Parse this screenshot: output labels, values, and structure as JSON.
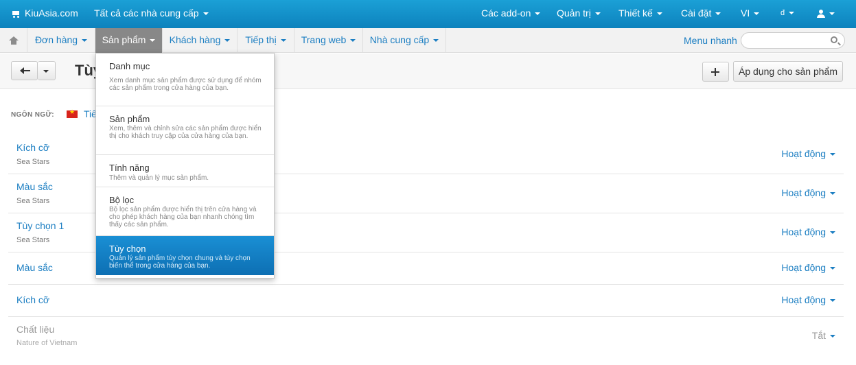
{
  "topbar": {
    "brand": "KiuAsia.com",
    "vendors": "Tất cả các nhà cung cấp",
    "menus": {
      "addons": "Các add-on",
      "admin": "Quản trị",
      "design": "Thiết kế",
      "settings": "Cài đặt",
      "language": "VI",
      "currency": "đ"
    },
    "icons": {
      "brand": "cart-icon",
      "account": "user-icon"
    }
  },
  "navbar": {
    "items": {
      "orders": "Đơn hàng",
      "products": "Sản phẩm",
      "customers": "Khách hàng",
      "marketing": "Tiếp thị",
      "website": "Trang web",
      "vendors": "Nhà cung cấp"
    },
    "quick_menu": "Menu nhanh",
    "search_placeholder": ""
  },
  "actionbar": {
    "title": "Tùy",
    "apply_button": "Áp dụng cho sản phẩm"
  },
  "content": {
    "language_label": "NGÔN NGỮ:",
    "language_value": "Tiế",
    "rows": [
      {
        "name": "Kích cỡ",
        "vendor": "Sea Stars",
        "status": "Hoạt động"
      },
      {
        "name": "Màu sắc",
        "vendor": "Sea Stars",
        "status": "Hoạt động"
      },
      {
        "name": "Tùy chọn 1",
        "vendor": "Sea Stars",
        "status": "Hoạt động"
      },
      {
        "name": "Màu sắc",
        "vendor": "",
        "status": "Hoạt động"
      },
      {
        "name": "Kích cỡ",
        "vendor": "",
        "status": "Hoạt động"
      },
      {
        "name": "Chất liệu",
        "vendor": "Nature of Vietnam",
        "status": "Tắt"
      }
    ]
  },
  "dropdown": {
    "items": [
      {
        "title": "Danh mục",
        "description": "Xem danh mục sản phẩm được sử dụng để nhóm các sản phẩm trong cửa hàng của bạn."
      },
      {
        "title": "Sản phẩm",
        "description": "Xem, thêm và chỉnh sửa các sản phẩm được hiển thị cho khách truy cập của cửa hàng của bạn."
      },
      {
        "title": "Tính năng",
        "description": "Thêm và quản lý mục sản phẩm."
      },
      {
        "title": "Bộ lọc",
        "description": "Bộ lọc sản phẩm được hiển thị trên cửa hàng và cho phép khách hàng của bạn nhanh chóng tìm thấy các sản phẩm."
      },
      {
        "title": "Tùy chọn",
        "description": "Quản lý sản phẩm tùy chọn chung và tùy chọn biến thể trong cửa hàng của bạn."
      }
    ],
    "selected": "Tùy chọn"
  },
  "colors": {
    "topbar": "#1ba0d6",
    "link": "#1b7ec2",
    "selected_item": "#1a8fd4",
    "nav_active": "#888888"
  }
}
